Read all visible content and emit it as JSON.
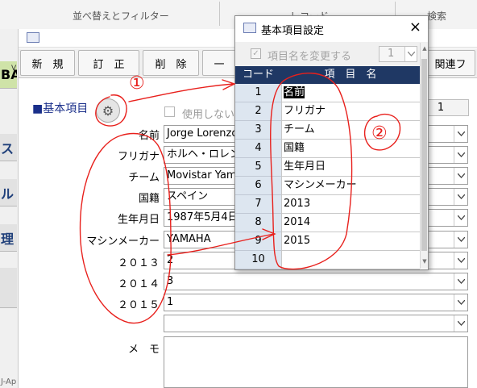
{
  "ribbon": {
    "group_sort": "並べ替えとフィルター",
    "group_record": "レコード",
    "group_search": "検索"
  },
  "leftnav": {
    "tabs": [
      "BA",
      "ス",
      "ル",
      "理",
      ""
    ],
    "v_label": "V",
    "bottom_text": "J-Ap"
  },
  "commands": [
    "新　規",
    "訂　正",
    "削　除",
    "一",
    "関連フ"
  ],
  "section": {
    "title": "■基本項目",
    "unused_label": "使用しない",
    "number": "1"
  },
  "fields": [
    {
      "label": "名前",
      "value": "Jorge Lorenzo"
    },
    {
      "label": "フリガナ",
      "value": "ホルヘ・ロレンソ"
    },
    {
      "label": "チーム",
      "value": "Movistar Yamaha"
    },
    {
      "label": "国籍",
      "value": "スペイン"
    },
    {
      "label": "生年月日",
      "value": "1987年5月4日"
    },
    {
      "label": "マシンメーカー",
      "value": "YAMAHA"
    },
    {
      "label": "２０１３",
      "value": "2"
    },
    {
      "label": "２０１４",
      "value": "3"
    },
    {
      "label": "２０１５",
      "value": "1"
    },
    {
      "label": "",
      "value": ""
    }
  ],
  "memo_label": "メ　モ",
  "dialog": {
    "title": "基本項目設定",
    "close": "×",
    "option_label": "項目名を変更する",
    "option_value": "1",
    "header_code": "コード",
    "header_name": "項　目　名",
    "rows": [
      {
        "code": "1",
        "name": "名前"
      },
      {
        "code": "2",
        "name": "フリガナ"
      },
      {
        "code": "3",
        "name": "チーム"
      },
      {
        "code": "4",
        "name": "国籍"
      },
      {
        "code": "5",
        "name": "生年月日"
      },
      {
        "code": "6",
        "name": "マシンメーカー"
      },
      {
        "code": "7",
        "name": "2013"
      },
      {
        "code": "8",
        "name": "2014"
      },
      {
        "code": "9",
        "name": "2015"
      },
      {
        "code": "10",
        "name": ""
      }
    ]
  },
  "annotations": {
    "circle_1": "①",
    "circle_2": "②",
    "ink_color": "#e8201c"
  },
  "colors": {
    "grid_header": "#1f3864",
    "code_cell": "#dde6f0",
    "section_title": "#1a2f8a"
  }
}
